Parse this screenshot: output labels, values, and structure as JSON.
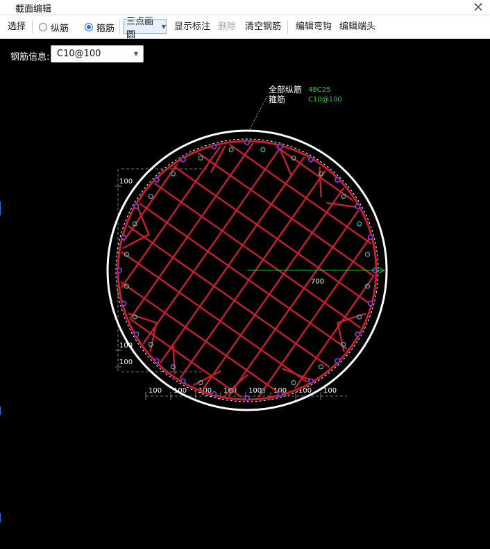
{
  "window": {
    "title": "截面编辑"
  },
  "toolbar": {
    "select_label": "选择",
    "longitudinal_label": "纵筋",
    "stirrup_label": "箍筋",
    "mode_label": "三点画圆",
    "show_annotation_label": "显示标注",
    "delete_label": "删除",
    "clear_rebar_label": "清空钢筋",
    "edit_hook_label": "编辑弯钩",
    "edit_end_label": "编辑端头",
    "selected_radio": "stirrup"
  },
  "info": {
    "label": "钢筋信息:",
    "value": "C10@100"
  },
  "drawing": {
    "annotation": {
      "longitudinal_label": "全部纵筋",
      "longitudinal_value": "48C25",
      "stirrup_label": "箍筋",
      "stirrup_value": "C10@100"
    },
    "radius_label": "700",
    "bottom_dims": [
      "100",
      "100",
      "100",
      "100",
      "100",
      "100",
      "100",
      "100"
    ],
    "left_dims": [
      "100",
      "100",
      "100"
    ],
    "colors": {
      "stirrup": "#c8202f",
      "section": "#ffffff",
      "dimension": "#ffffff",
      "radius_line": "#19c619",
      "annotation_value": "#26d626",
      "rebar": "#a040e0",
      "cyan_marker": "#4fd6d6"
    }
  },
  "icons": {
    "close": "close-icon",
    "dropdown": "chevron-down-icon"
  }
}
